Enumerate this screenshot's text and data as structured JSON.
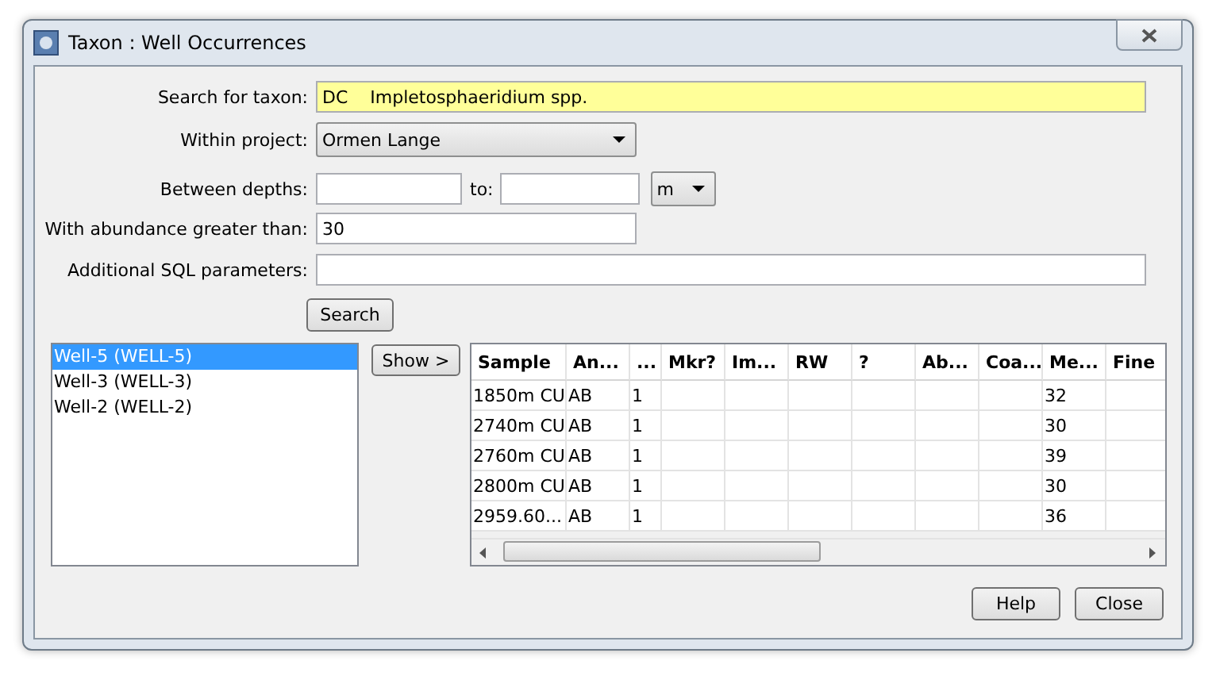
{
  "window": {
    "title": "Taxon : Well Occurrences"
  },
  "form": {
    "taxon": {
      "label": "Search for taxon:",
      "value": "DC    Impletosphaeridium spp."
    },
    "project": {
      "label": "Within project:",
      "value": "Ormen Lange"
    },
    "depths": {
      "label": "Between depths:",
      "to_label": "to:",
      "unit": "m"
    },
    "abundance": {
      "label": "With abundance greater than:",
      "value": "30"
    },
    "sql": {
      "label": "Additional SQL parameters:"
    },
    "search_button": "Search"
  },
  "wells": [
    {
      "label": "Well-5 (WELL-5)",
      "selected": true
    },
    {
      "label": "Well-3 (WELL-3)",
      "selected": false
    },
    {
      "label": "Well-2 (WELL-2)",
      "selected": false
    }
  ],
  "show_button": "Show >",
  "table": {
    "columns": [
      "Sample",
      "An...",
      "...",
      "Mkr?",
      "Im...",
      "RW",
      "?",
      "Ab...",
      "Coa...",
      "Me...",
      "Fine"
    ],
    "rows": [
      [
        "1850m CU",
        "AB",
        "1",
        null,
        null,
        null,
        null,
        null,
        null,
        "32",
        null
      ],
      [
        "2740m CU",
        "AB",
        "1",
        null,
        null,
        null,
        null,
        null,
        null,
        "30",
        null
      ],
      [
        "2760m CU",
        "AB",
        "1",
        null,
        null,
        null,
        null,
        null,
        null,
        "39",
        null
      ],
      [
        "2800m CU",
        "AB",
        "1",
        null,
        null,
        null,
        null,
        null,
        null,
        "30",
        null
      ],
      [
        "2959.60...",
        "AB",
        "1",
        null,
        null,
        null,
        null,
        null,
        null,
        "36",
        null
      ]
    ]
  },
  "buttons": [
    "Help",
    "Close"
  ]
}
